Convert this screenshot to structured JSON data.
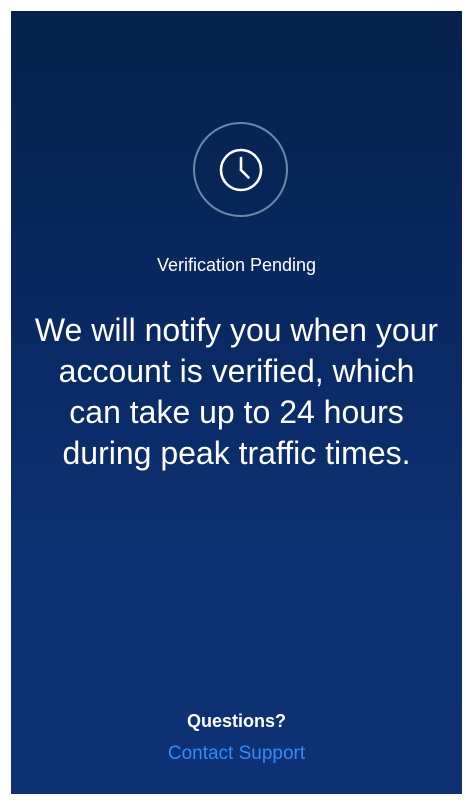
{
  "status": {
    "icon": "clock-icon",
    "title": "Verification Pending"
  },
  "message": "We will notify you when your account is verified, which can take up to 24 hours during peak traffic times.",
  "footer": {
    "questions_label": "Questions?",
    "contact_link_label": "Contact Support"
  },
  "colors": {
    "background_top": "#06214a",
    "background_bottom": "#0d3172",
    "ring": "#6f86a8",
    "text": "#ffffff",
    "link": "#2f8cff"
  }
}
